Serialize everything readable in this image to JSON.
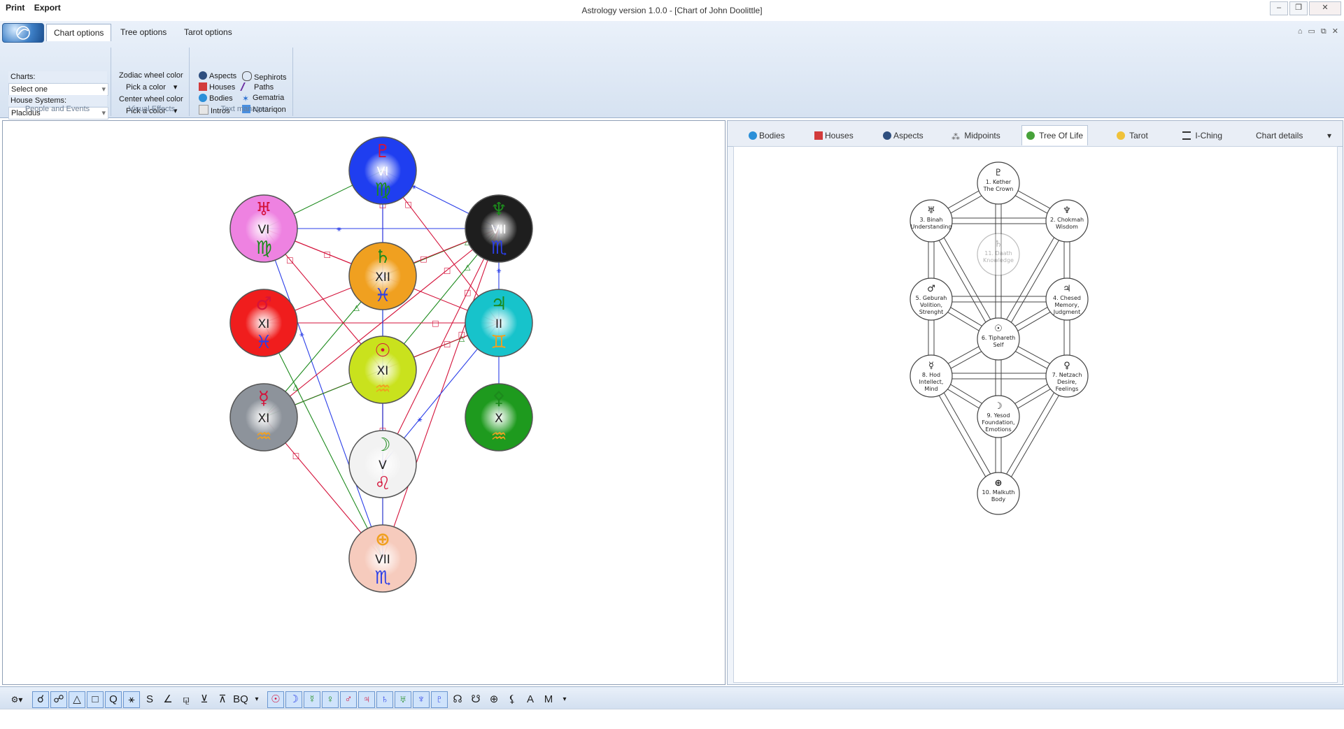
{
  "quick_access": {
    "print": "Print",
    "export": "Export"
  },
  "window_title": "Astrology version 1.0.0 - [Chart of John Doolittle]",
  "ribbon": {
    "tabs": [
      "Chart options",
      "Tree options",
      "Tarot options"
    ],
    "people_events": {
      "charts_label": "Charts:",
      "charts_value": "Select one",
      "house_label": "House Systems:",
      "house_value": "Placidus",
      "group_label": "People and Events"
    },
    "visual_effects": {
      "zodiac_label": "Zodiac wheel color",
      "zodiac_pick": "Pick a color",
      "center_label": "Center wheel color",
      "center_pick": "Pick a color",
      "group_label": "Visual Effects"
    },
    "text_manager": {
      "items_left": [
        "Aspects",
        "Houses",
        "Bodies",
        "Intros"
      ],
      "items_right": [
        "Sephirots",
        "Paths",
        "Gematria",
        "Notariqon"
      ],
      "group_label": "Text manager"
    }
  },
  "planet_nodes": [
    {
      "symbol": "♇",
      "house": "VI",
      "sign": "♍",
      "fill": "#1f3ef0",
      "sym_color": "#d4133b",
      "sign_color": "#1c8a1c"
    },
    {
      "symbol": "♅",
      "house": "VI",
      "sign": "♍",
      "fill": "#ee82e1",
      "sym_color": "#d4133b",
      "sign_color": "#1c8a1c"
    },
    {
      "symbol": "♆",
      "house": "VII",
      "sign": "♏",
      "fill": "#1e1e1e",
      "sym_color": "#1c8a1c",
      "sign_color": "#2b3fe8"
    },
    {
      "symbol": "♄",
      "house": "XII",
      "sign": "♓",
      "fill": "#f0a020",
      "sym_color": "#1c8a1c",
      "sign_color": "#2b3fe8"
    },
    {
      "symbol": "♂",
      "house": "XI",
      "sign": "♓",
      "fill": "#f01d1d",
      "sym_color": "#d4133b",
      "sign_color": "#2b3fe8"
    },
    {
      "symbol": "♃",
      "house": "II",
      "sign": "♊",
      "fill": "#17c3cb",
      "sym_color": "#1c8a1c",
      "sign_color": "#f0a020"
    },
    {
      "symbol": "☉",
      "house": "XI",
      "sign": "♒",
      "fill": "#c9e21d",
      "sym_color": "#d4133b",
      "sign_color": "#f0a020"
    },
    {
      "symbol": "☿",
      "house": "XI",
      "sign": "♒",
      "fill": "#8d939b",
      "sym_color": "#d4133b",
      "sign_color": "#f0a020"
    },
    {
      "symbol": "⚴",
      "house": "X",
      "sign": "♒",
      "fill": "#1e9a1e",
      "sym_color": "#1c8a1c",
      "sign_color": "#f0a020"
    },
    {
      "symbol": "☽",
      "house": "V",
      "sign": "♌",
      "fill": "#f2f2f2",
      "sym_color": "#1c8a1c",
      "sign_color": "#d4133b"
    },
    {
      "symbol": "⊕",
      "house": "VII",
      "sign": "♏",
      "fill": "#f6cbbd",
      "sym_color": "#f0a020",
      "sign_color": "#2b3fe8"
    }
  ],
  "panel_tabs": [
    "Bodies",
    "Houses",
    "Aspects",
    "Midpoints",
    "Tree Of Life",
    "Tarot",
    "I-Ching",
    "Chart details"
  ],
  "sephirot": [
    {
      "symbol": "♇",
      "lines": [
        "1. Kether",
        "The Crown"
      ]
    },
    {
      "symbol": "♅",
      "lines": [
        "3. Binah",
        "Understanding"
      ]
    },
    {
      "symbol": "♆",
      "lines": [
        "2. Chokmah",
        "Wisdom"
      ]
    },
    {
      "symbol": "♄",
      "lines": [
        "11. Daath",
        "Knowledge"
      ]
    },
    {
      "symbol": "♂",
      "lines": [
        "5. Geburah",
        "Volition,",
        "Strenght"
      ]
    },
    {
      "symbol": "♃",
      "lines": [
        "4. Chesed",
        "Memory,",
        "Judgment"
      ]
    },
    {
      "symbol": "☉",
      "lines": [
        "6. Tiphareth",
        "Self"
      ]
    },
    {
      "symbol": "☿",
      "lines": [
        "8. Hod",
        "Intellect,",
        "Mind"
      ]
    },
    {
      "symbol": "♀",
      "lines": [
        "7. Netzach",
        "Desire,",
        "Feelings"
      ]
    },
    {
      "symbol": "☽",
      "lines": [
        "9. Yesod",
        "Foundation,",
        "Emotions"
      ]
    },
    {
      "symbol": "⊕",
      "lines": [
        "10. Malkuth",
        "Body"
      ]
    }
  ],
  "aspect_tools": [
    "☌",
    "☍",
    "△",
    "□",
    "Q",
    "⚹",
    "S",
    "∠",
    "⚼",
    "⊻",
    "⊼",
    "BQ"
  ],
  "body_tools": [
    "☉",
    "☽",
    "☿",
    "♀",
    "♂",
    "♃",
    "♄",
    "♅",
    "♆",
    "♇",
    "☊",
    "☋",
    "⊕",
    "⚸",
    "A",
    "M"
  ],
  "colors": {
    "red": "#d4133b",
    "green": "#1c8a1c",
    "blue": "#2b3fe8",
    "orange": "#f0a020"
  }
}
